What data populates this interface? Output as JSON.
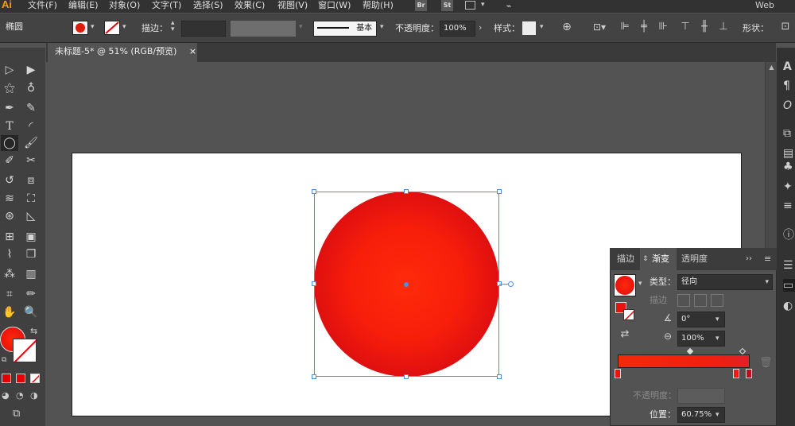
{
  "app": {
    "logo": "Ai",
    "workspace": "Web"
  },
  "menu": [
    {
      "label": "文件(F)"
    },
    {
      "label": "编辑(E)"
    },
    {
      "label": "对象(O)"
    },
    {
      "label": "文字(T)"
    },
    {
      "label": "选择(S)"
    },
    {
      "label": "效果(C)"
    },
    {
      "label": "视图(V)"
    },
    {
      "label": "窗口(W)"
    },
    {
      "label": "帮助(H)"
    }
  ],
  "menu_badges": {
    "br": "Br",
    "st": "St"
  },
  "control": {
    "object_type": "椭圆",
    "stroke_label": "描边：",
    "brush_label": "基本",
    "opacity_label": "不透明度：",
    "opacity_value": "100%",
    "style_label": "样式：",
    "shape_label": "形状："
  },
  "document": {
    "tab_title": "未标题-5* @ 51% (RGB/预览)",
    "close": "×"
  },
  "gradient_panel": {
    "tabs": [
      "描边",
      "渐变",
      "透明度"
    ],
    "type_label": "类型：",
    "type_value": "径向",
    "stroke_label": "描边",
    "angle_value": "0°",
    "ratio_value": "100%",
    "opacity_label": "不透明度：",
    "position_label": "位置：",
    "position_value": "60.75%"
  },
  "colors": {
    "fill": "#ff1a0a",
    "gradient_center": "#ff2a0a",
    "gradient_edge": "#b8121a",
    "selection": "#4c8dea",
    "accent": "#ff9a00"
  }
}
